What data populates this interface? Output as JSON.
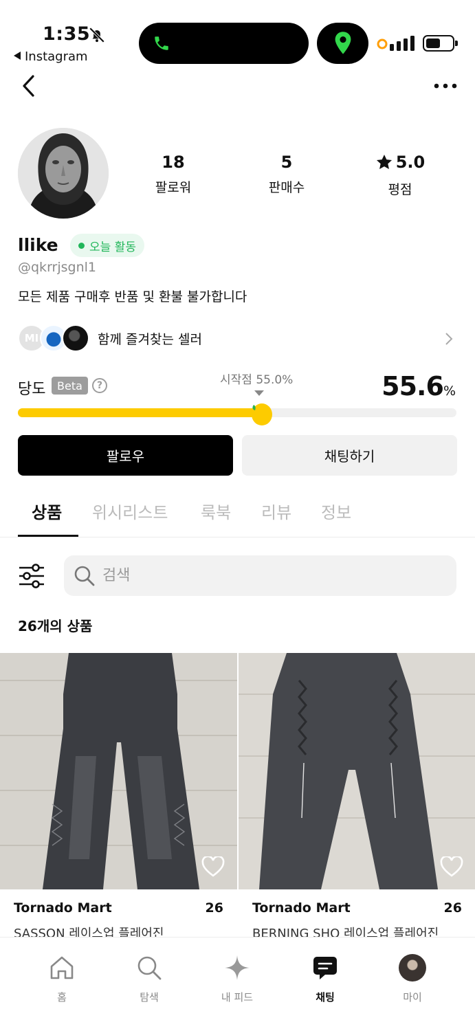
{
  "status_bar": {
    "time": "1:35",
    "back_app": "Instagram",
    "icons": [
      "bell-slash-icon",
      "phone-icon",
      "location-pin-icon",
      "signal-icon",
      "battery-icon"
    ]
  },
  "nav": {
    "back_icon": "chevron-left-icon",
    "more_icon": "more-dots-icon"
  },
  "profile": {
    "stats": [
      {
        "value": "18",
        "label": "팔로워"
      },
      {
        "value": "5",
        "label": "판매수"
      },
      {
        "value": "5.0",
        "label": "평점"
      }
    ],
    "name": "llike",
    "activity_badge": "오늘 활동",
    "handle": "@qkrrjsgnl1",
    "bio": "모든 제품 구매후 반품 및 환불 불가합니다",
    "favorites_avatar_initials": "MI",
    "favorites_label": "함께 즐겨찾는 셀러"
  },
  "temperature": {
    "label": "당도",
    "beta": "Beta",
    "help": "?",
    "start_label": "시작점 55.0%",
    "value": "55.6",
    "unit": "%",
    "level_percent": 55.6,
    "bar_color": "#fdcb00"
  },
  "actions": {
    "follow": "팔로우",
    "chat": "채팅하기"
  },
  "tabs": [
    "상품",
    "위시리스트",
    "룩북",
    "리뷰",
    "정보"
  ],
  "search": {
    "placeholder": "검색"
  },
  "product_count": "26개의 상품",
  "products": [
    {
      "seller": "Tornado Mart",
      "likes": "26",
      "title": "SASSON 레이스업 플레어진"
    },
    {
      "seller": "Tornado Mart",
      "likes": "26",
      "title": "BERNING SHO 레이스업 플레어진"
    }
  ],
  "bottom_nav": [
    {
      "label": "홈",
      "icon": "home-icon"
    },
    {
      "label": "탐색",
      "icon": "search-icon"
    },
    {
      "label": "내 피드",
      "icon": "sparkle-icon"
    },
    {
      "label": "채팅",
      "icon": "chat-icon"
    },
    {
      "label": "마이",
      "icon": "avatar"
    }
  ],
  "colors": {
    "accent_yellow": "#fdcb00",
    "active_green": "#21b65a",
    "black": "#000000"
  }
}
